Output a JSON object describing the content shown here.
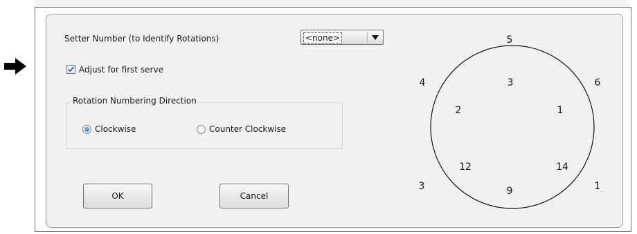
{
  "form": {
    "setter_label": "Setter Number (to Identify Rotations)",
    "setter_value": "<none>",
    "adjust_label": "Adjust for first serve",
    "adjust_checked": true,
    "group_title": "Rotation Numbering Direction",
    "clockwise_label": "Clockwise",
    "counter_label": "Counter Clockwise",
    "selected_direction": "Clockwise"
  },
  "buttons": {
    "ok_label": "OK",
    "cancel_label": "Cancel"
  },
  "diagram": {
    "outer": {
      "top": "5",
      "upper_left": "4",
      "upper_right": "6",
      "lower_left": "3",
      "lower_right": "1"
    },
    "inner": {
      "top": "3",
      "upper_left": "2",
      "upper_right": "1",
      "lower_left": "12",
      "lower_right": "14",
      "bottom": "9"
    }
  },
  "colors": {
    "dialog_bg": "#f1f1f1",
    "accent": "#1f6fba"
  },
  "icons": {
    "pointer": "arrow-right-icon",
    "dropdown": "chevron-down-icon",
    "check": "checkmark-icon"
  }
}
